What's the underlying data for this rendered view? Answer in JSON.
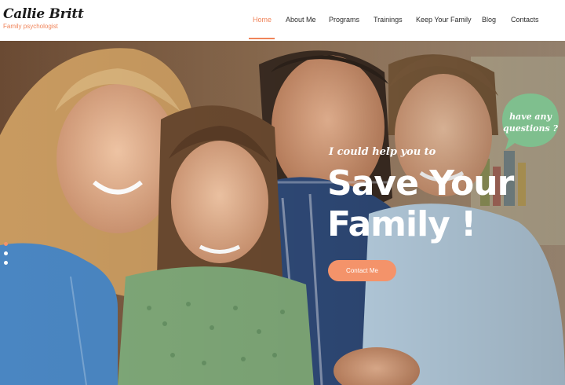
{
  "brand": {
    "name": "Callie Britt",
    "tagline": "Family psychologist"
  },
  "nav": {
    "items": [
      {
        "label": "Home",
        "active": true
      },
      {
        "label": "About Me",
        "active": false
      },
      {
        "label": "Programs",
        "active": false
      },
      {
        "label": "Trainings",
        "active": false
      },
      {
        "label": "Keep Your Family",
        "active": false
      },
      {
        "label": "Blog",
        "active": false
      },
      {
        "label": "Contacts",
        "active": false
      }
    ]
  },
  "hero": {
    "script": "I could help you to",
    "title_line1": "Save Your",
    "title_line2": "Family !",
    "button": "Contact Me",
    "slider_dots": 3,
    "active_dot": 1
  },
  "bubble": {
    "line1": "have any",
    "line2": "questions ?"
  },
  "colors": {
    "accent": "#f0845a",
    "button": "#f4936a",
    "bubble": "#7fbf8e",
    "text_dark": "#2b2b2b"
  }
}
